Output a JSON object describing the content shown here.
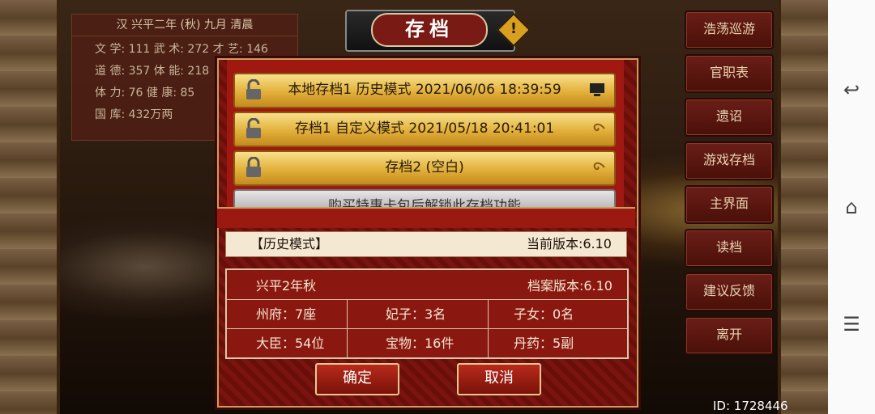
{
  "stats": {
    "title": "汉 兴平二年 (秋) 九月 清晨",
    "line1": "文 学: 111   武 术: 272   才 艺: 146",
    "line2": "道 德: 357   体 能: 218",
    "line3": "体 力: 76    健 康: 85",
    "line4": "国 库: 432万两"
  },
  "dialog": {
    "title": "存档",
    "slots": [
      {
        "label": "本地存档1  历史模式  2021/06/06 18:39:59"
      },
      {
        "label": "存档1  自定义模式  2021/05/18 20:41:01"
      },
      {
        "label": "存档2      (空白)"
      },
      {
        "label": "购买特惠卡包后解锁此存档功能"
      }
    ],
    "info": {
      "mode": "【历史模式】",
      "current_version": "当前版本:6.10",
      "date": "兴平2年秋",
      "save_version": "档案版本:6.10",
      "cells": [
        "州府：7座",
        "妃子：3名",
        "子女：0名",
        "大臣：54位",
        "宝物：16件",
        "丹药：5副"
      ]
    },
    "confirm": "确定",
    "cancel": "取消"
  },
  "menu": [
    "浩荡巡游",
    "官职表",
    "遗诏",
    "游戏存档",
    "主界面",
    "读档",
    "建议反馈",
    "离开"
  ],
  "id_text": "ID: 1728446",
  "colors": {
    "accent": "#7a1a14",
    "gold": "#e2b03a"
  }
}
